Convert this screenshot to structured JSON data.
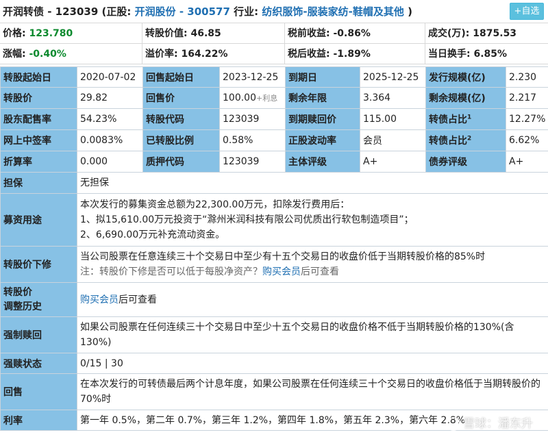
{
  "header": {
    "bond_name": "开润转债 - 123039",
    "stock_prefix": "(正股:",
    "stock_link": "开润股份 - 300577",
    "industry_prefix": "行业:",
    "industry_link": "纺织服饰-服装家纺-鞋帽及其他",
    "suffix": ")",
    "add_button": "+自选"
  },
  "quote": {
    "row1": [
      {
        "label": "价格:",
        "value": "123.780"
      },
      {
        "label": "转股价值:",
        "value": "46.85"
      },
      {
        "label": "税前收益:",
        "value": "-0.86%"
      },
      {
        "label": "成交(万):",
        "value": "1875.53"
      }
    ],
    "row2": [
      {
        "label": "涨幅:",
        "value": "-0.40%"
      },
      {
        "label": "溢价率:",
        "value": "164.22%"
      },
      {
        "label": "税后收益:",
        "value": "-1.89%"
      },
      {
        "label": "当日换手:",
        "value": "6.85%"
      }
    ]
  },
  "grid": [
    [
      [
        "转股起始日",
        "2020-07-02"
      ],
      [
        "回售起始日",
        "2023-12-25"
      ],
      [
        "到期日",
        "2025-12-25"
      ],
      [
        "发行规模(亿)",
        "2.230"
      ]
    ],
    [
      [
        "转股价",
        "29.82"
      ],
      [
        "回售价",
        "100.00"
      ],
      [
        "剩余年限",
        "3.364"
      ],
      [
        "剩余规模(亿)",
        "2.217"
      ]
    ],
    [
      [
        "股东配售率",
        "54.23%"
      ],
      [
        "转股代码",
        "123039"
      ],
      [
        "到期赎回价",
        "115.00"
      ],
      [
        "转债占比",
        "12.27%"
      ]
    ],
    [
      [
        "网上中签率",
        "0.0083%"
      ],
      [
        "已转股比例",
        "0.58%"
      ],
      [
        "正股波动率",
        "会员"
      ],
      [
        "转债占比",
        "6.62%"
      ]
    ],
    [
      [
        "折算率",
        "0.000"
      ],
      [
        "质押代码",
        "123039"
      ],
      [
        "主体评级",
        "A+"
      ],
      [
        "债券评级",
        "A+"
      ]
    ]
  ],
  "extras": {
    "put_price_suffix": "+利息",
    "sup1": "1",
    "sup2": "2"
  },
  "details": {
    "guarantee": {
      "label": "担保",
      "text": "无担保"
    },
    "funds": {
      "label": "募资用途",
      "lines": [
        "本次发行的募集资金总额为22,300.00万元，扣除发行费用后：",
        "1、拟15,610.00万元投资于“滁州米润科技有限公司优质出行软包制造项目”；",
        "2、6,690.00万元补充流动资金。"
      ]
    },
    "reset": {
      "label": "转股价下修",
      "line1": "当公司股票在任意连续三十个交易日中至少有十五个交易日的收盘价低于当期转股价格的85%时",
      "note_prefix": "注：转股价下修是否可以低于每股净资产？",
      "note_link": "购买会员",
      "note_suffix": "后可查看"
    },
    "history": {
      "label_line1": "转股价",
      "label_line2": "调整历史",
      "link": "购买会员",
      "suffix": "后可查看"
    },
    "redeem": {
      "label": "强制赎回",
      "text": "如果公司股票在任何连续三十个交易日中至少十五个交易日的收盘价格不低于当期转股价格的130%(含 130%)"
    },
    "redeem_status": {
      "label": "强赎状态",
      "text": "0/15 | 30"
    },
    "putback": {
      "label": "回售",
      "text": "在本次发行的可转债最后两个计息年度，如果公司股票在任何连续三十个交易日的收盘价格低于当期转股价的70%时"
    },
    "rate": {
      "label": "利率",
      "text": "第一年 0.5%，第二年 0.7%，第三年 1.2%，第四年 1.8%，第五年 2.3%，第六年 2.8%"
    }
  },
  "watermark": "雪球：潘东升",
  "colors": {
    "label_bg": "#87c1e5",
    "link": "#1f6fb2",
    "negative": "#0c8a2e",
    "button": "#5bc0de"
  }
}
